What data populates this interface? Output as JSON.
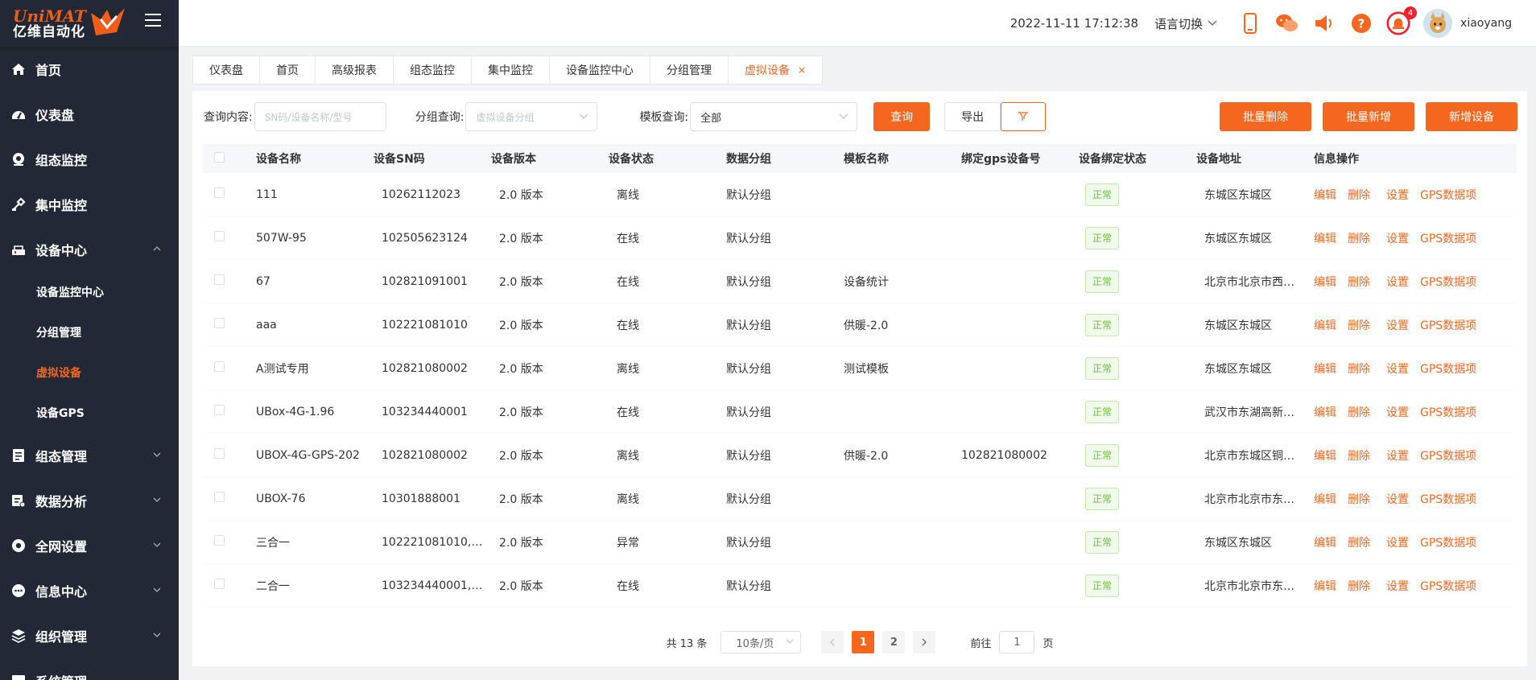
{
  "logo": {
    "line1": "UniMAT",
    "line2": "亿维自动化"
  },
  "sidebar": {
    "items": [
      {
        "label": "首页",
        "icon": "home-icon"
      },
      {
        "label": "仪表盘",
        "icon": "dashboard-icon"
      },
      {
        "label": "组态监控",
        "icon": "monitor-icon"
      },
      {
        "label": "集中监控",
        "icon": "tools-icon"
      },
      {
        "label": "设备中心",
        "icon": "device-icon",
        "expanded": true
      },
      {
        "label": "组态管理",
        "icon": "config-icon"
      },
      {
        "label": "数据分析",
        "icon": "analysis-icon"
      },
      {
        "label": "全网设置",
        "icon": "settings-icon"
      },
      {
        "label": "信息中心",
        "icon": "message-icon"
      },
      {
        "label": "组织管理",
        "icon": "org-icon"
      },
      {
        "label": "系统管理",
        "icon": "system-icon"
      }
    ],
    "subitems": [
      {
        "label": "设备监控中心"
      },
      {
        "label": "分组管理"
      },
      {
        "label": "虚拟设备",
        "active": true
      },
      {
        "label": "设备GPS"
      }
    ]
  },
  "header": {
    "datetime": "2022-11-11 17:12:38",
    "language": "语言切换",
    "notify_count": "4",
    "username": "xiaoyang"
  },
  "tabs": [
    {
      "label": "仪表盘"
    },
    {
      "label": "首页"
    },
    {
      "label": "高级报表"
    },
    {
      "label": "组态监控"
    },
    {
      "label": "集中监控"
    },
    {
      "label": "设备监控中心"
    },
    {
      "label": "分组管理"
    },
    {
      "label": "虚拟设备",
      "active": true,
      "close": "×"
    }
  ],
  "filters": {
    "query_label": "查询内容:",
    "query_placeholder": "SN码/设备名称/型号",
    "group_label": "分组查询:",
    "group_placeholder": "虚拟设备分组",
    "template_label": "模板查询:",
    "template_value": "全部",
    "search_btn": "查询",
    "export_btn": "导出"
  },
  "actions": {
    "batch_delete": "批量删除",
    "batch_add": "批量新增",
    "add_device": "新增设备"
  },
  "table": {
    "headers": [
      "设备名称",
      "设备SN码",
      "设备版本",
      "设备状态",
      "数据分组",
      "模板名称",
      "绑定gps设备号",
      "设备绑定状态",
      "设备地址",
      "信息操作"
    ],
    "ops": {
      "edit": "编辑",
      "delete": "删除",
      "settings": "设置",
      "gps": "GPS数据项"
    },
    "rows": [
      {
        "name": "111",
        "sn": "10262112023",
        "version": "2.0 版本",
        "status": "离线",
        "group": "默认分组",
        "template": "",
        "gps": "",
        "bind": "正常",
        "address": "东城区东城区"
      },
      {
        "name": "507W-95",
        "sn": "102505623124",
        "version": "2.0 版本",
        "status": "在线",
        "group": "默认分组",
        "template": "",
        "gps": "",
        "bind": "正常",
        "address": "东城区东城区"
      },
      {
        "name": "67",
        "sn": "102821091001",
        "version": "2.0 版本",
        "status": "在线",
        "group": "默认分组",
        "template": "设备统计",
        "gps": "",
        "bind": "正常",
        "address": "北京市北京市西…"
      },
      {
        "name": "aaa",
        "sn": "102221081010",
        "version": "2.0 版本",
        "status": "在线",
        "group": "默认分组",
        "template": "供暖-2.0",
        "gps": "",
        "bind": "正常",
        "address": "东城区东城区"
      },
      {
        "name": "A测试专用",
        "sn": "102821080002",
        "version": "2.0 版本",
        "status": "离线",
        "group": "默认分组",
        "template": "测试模板",
        "gps": "",
        "bind": "正常",
        "address": "东城区东城区"
      },
      {
        "name": "UBox-4G-1.96",
        "sn": "103234440001",
        "version": "2.0 版本",
        "status": "在线",
        "group": "默认分组",
        "template": "",
        "gps": "",
        "bind": "正常",
        "address": "武汉市东湖高新…"
      },
      {
        "name": "UBOX-4G-GPS-202",
        "sn": "102821080002",
        "version": "2.0 版本",
        "status": "离线",
        "group": "默认分组",
        "template": "供暖-2.0",
        "gps": "102821080002",
        "bind": "正常",
        "address": "北京市东城区铜…"
      },
      {
        "name": "UBOX-76",
        "sn": "10301888001",
        "version": "2.0 版本",
        "status": "离线",
        "group": "默认分组",
        "template": "",
        "gps": "",
        "bind": "正常",
        "address": "北京市北京市东…"
      },
      {
        "name": "三合一",
        "sn": "102221081010,…",
        "version": "2.0 版本",
        "status": "异常",
        "group": "默认分组",
        "template": "",
        "gps": "",
        "bind": "正常",
        "address": "东城区东城区"
      },
      {
        "name": "二合一",
        "sn": "103234440001,…",
        "version": "2.0 版本",
        "status": "在线",
        "group": "默认分组",
        "template": "",
        "gps": "",
        "bind": "正常",
        "address": "北京市北京市东…"
      }
    ]
  },
  "pagination": {
    "total": "共 13 条",
    "page_size": "10条/页",
    "pages": [
      "1",
      "2"
    ],
    "goto_label": "前往",
    "goto_value": "1",
    "page_unit": "页"
  },
  "colors": {
    "accent": "#f5671f",
    "sidebar_bg": "#222835",
    "success": "#67c23a"
  }
}
